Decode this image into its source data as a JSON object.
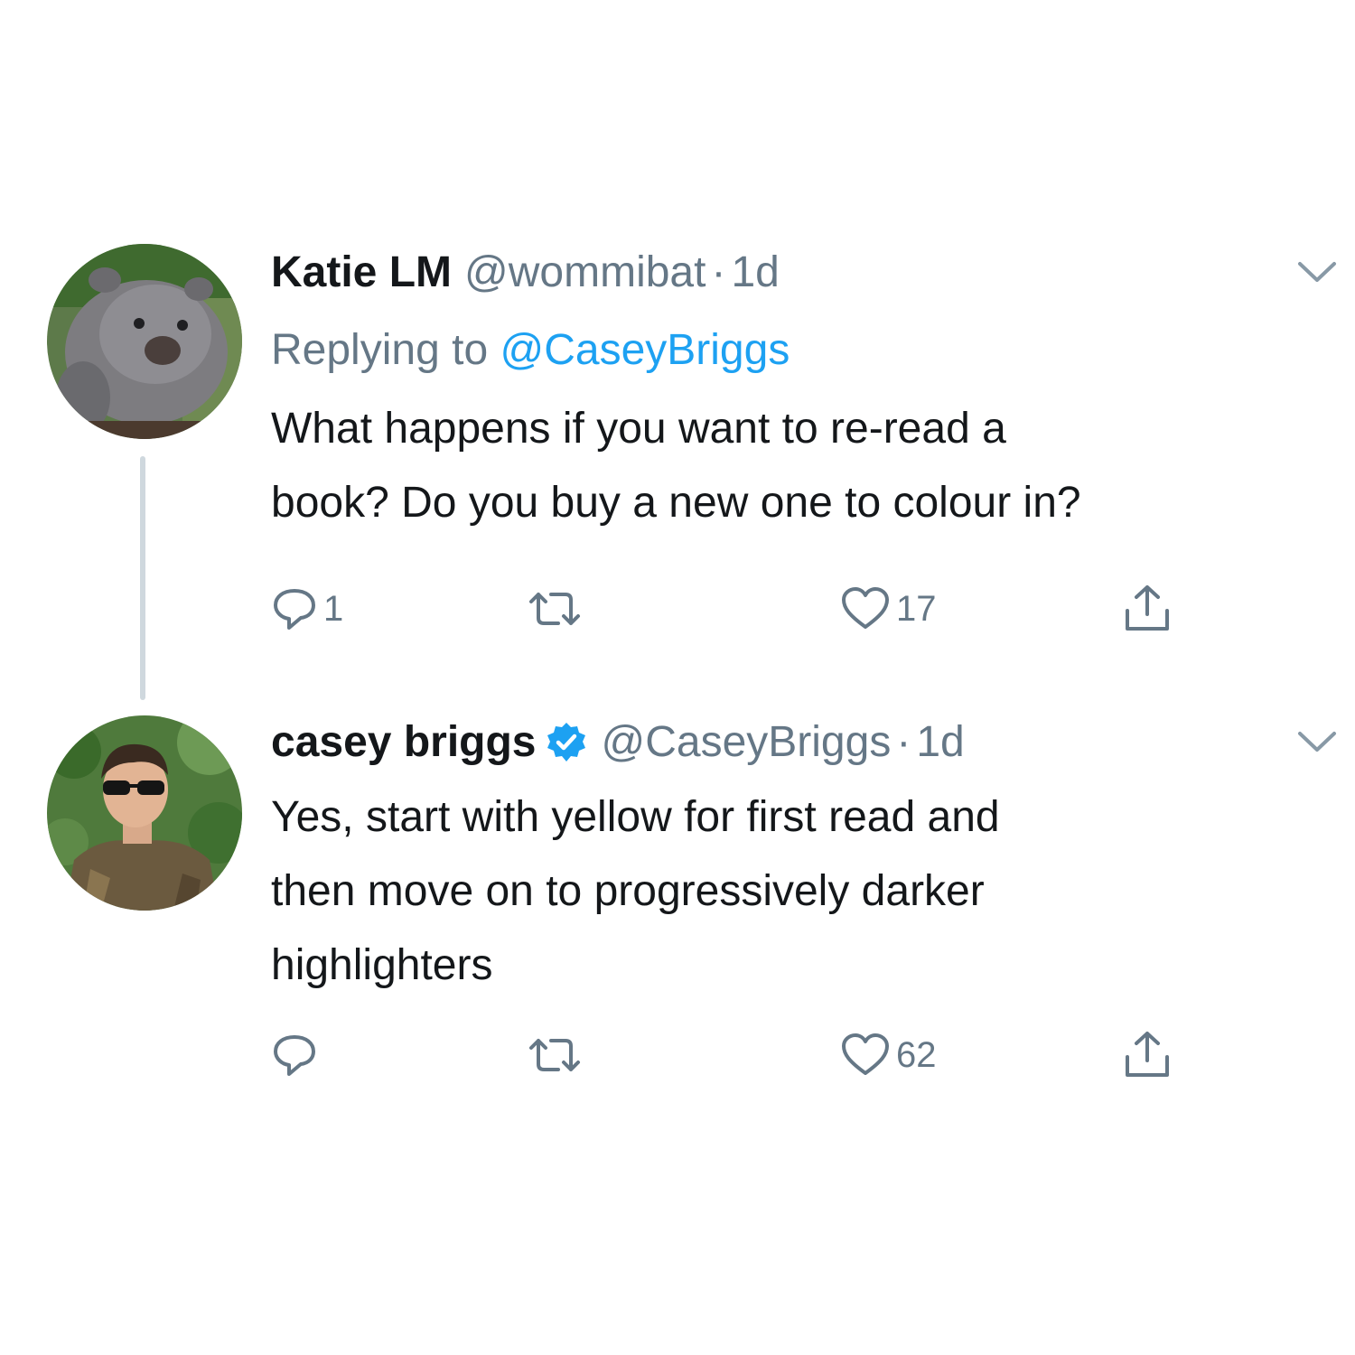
{
  "colors": {
    "text": "#14171a",
    "secondary": "#657786",
    "link": "#1da1f2",
    "verified": "#1da1f2",
    "thread_line": "#cfd8de"
  },
  "tweets": [
    {
      "display_name": "Katie LM",
      "handle": "@wommibat",
      "separator": "·",
      "time": "1d",
      "avatar": "wombat-avatar",
      "verified": false,
      "replying_prefix": "Replying to",
      "replying_to": "@CaseyBriggs",
      "text_lines": [
        "What happens if you want to re-read a",
        "book? Do you buy a new one to colour in?"
      ],
      "actions": {
        "reply_count": "1",
        "retweet_count": "",
        "like_count": "17",
        "reply_icon": "reply-icon",
        "retweet_icon": "retweet-icon",
        "like_icon": "heart-icon",
        "share_icon": "share-icon"
      }
    },
    {
      "display_name": "casey briggs",
      "handle": "@CaseyBriggs",
      "separator": "·",
      "time": "1d",
      "avatar": "man-with-sunglasses-avatar",
      "verified": true,
      "text_lines": [
        "Yes, start with yellow for first read and",
        "then move on to progressively darker",
        "highlighters"
      ],
      "actions": {
        "reply_count": "",
        "retweet_count": "",
        "like_count": "62",
        "reply_icon": "reply-icon",
        "retweet_icon": "retweet-icon",
        "like_icon": "heart-icon",
        "share_icon": "share-icon"
      }
    }
  ]
}
